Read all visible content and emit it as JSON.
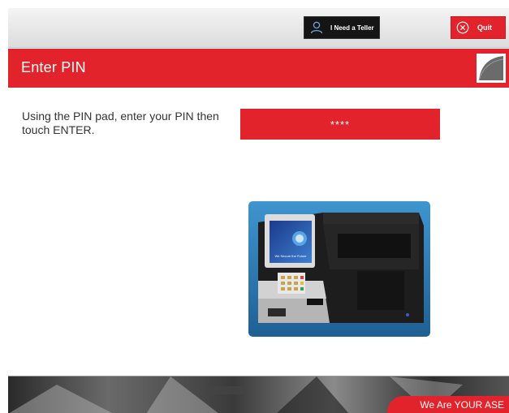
{
  "header": {
    "teller_label": "I Need a Teller",
    "quit_label": "Quit",
    "teller_icon": "person-icon",
    "quit_icon": "close-circle-icon"
  },
  "title": {
    "text": "Enter PIN"
  },
  "main": {
    "instruction": "Using the PIN pad, enter your PIN then touch ENTER.",
    "pin_value": "****",
    "device_screen_caption": "We Secure the Future"
  },
  "footer": {
    "tagline": "We Are YOUR ASE"
  },
  "colors": {
    "accent_red": "#e3232b",
    "teller_button_bg": "#151515",
    "device_frame_blue": "#2f7fb9"
  }
}
